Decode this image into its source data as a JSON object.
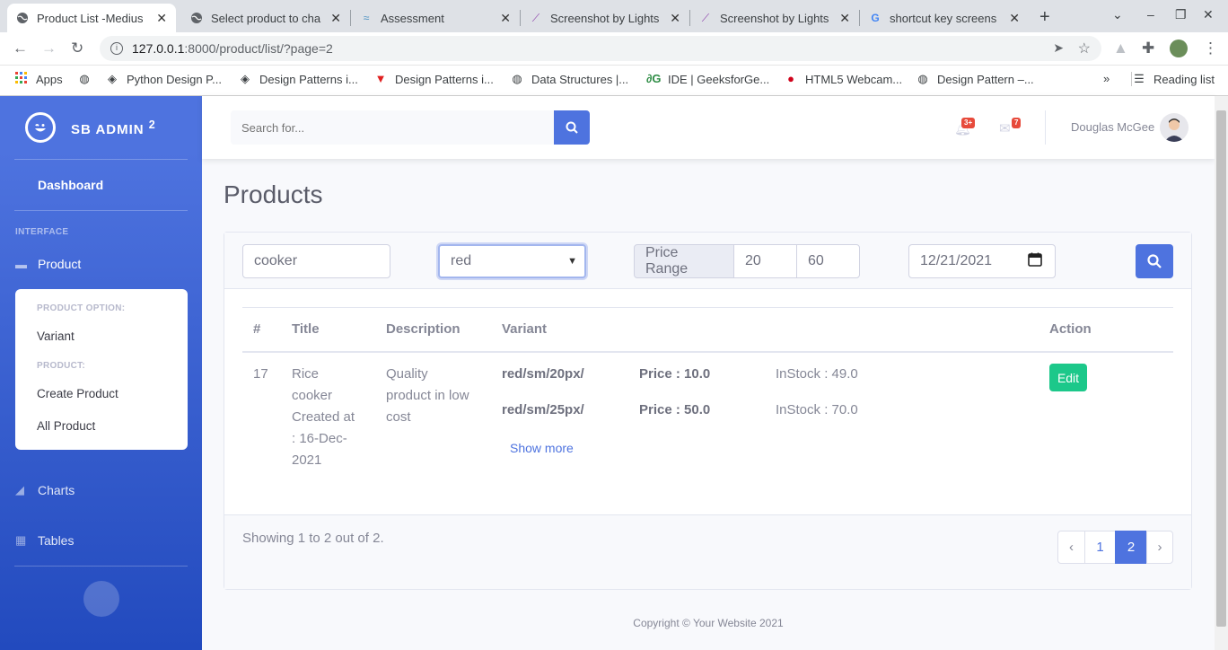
{
  "browser": {
    "tabs": [
      {
        "title": "Product List -Medius",
        "icon": "globe-icon",
        "active": true
      },
      {
        "title": "Select product to cha",
        "icon": "globe-icon"
      },
      {
        "title": "Assessment",
        "icon": "cloud-icon"
      },
      {
        "title": "Screenshot by Lights",
        "icon": "feather-icon"
      },
      {
        "title": "Screenshot by Lights",
        "icon": "feather-icon"
      },
      {
        "title": "shortcut key screens",
        "icon": "google-icon"
      }
    ],
    "url_host": "127.0.0.1",
    "url_path": ":8000/product/list/?page=2",
    "bookmarks": [
      {
        "label": "Apps",
        "icon": "apps-grid-icon"
      },
      {
        "label": "",
        "icon": "globe-icon"
      },
      {
        "label": "Python Design P...",
        "icon": "diamond-icon"
      },
      {
        "label": "Design Patterns i...",
        "icon": "diamond-icon"
      },
      {
        "label": "Design Patterns i...",
        "icon": "triangle-icon"
      },
      {
        "label": "Data Structures |...",
        "icon": "globe-icon"
      },
      {
        "label": "IDE | GeeksforGe...",
        "icon": "geeks-icon"
      },
      {
        "label": "HTML5 Webcam...",
        "icon": "red-dot-icon"
      },
      {
        "label": "Design Pattern –...",
        "icon": "globe-icon"
      }
    ],
    "reading_list": "Reading list"
  },
  "sidebar": {
    "brand": "SB ADMIN",
    "brand_sup": "2",
    "dashboard": "Dashboard",
    "interface_heading": "INTERFACE",
    "product": "Product",
    "product_option_heading": "PRODUCT OPTION:",
    "variant": "Variant",
    "product_heading": "PRODUCT:",
    "create_product": "Create Product",
    "all_product": "All Product",
    "charts": "Charts",
    "tables": "Tables"
  },
  "topbar": {
    "search_placeholder": "Search for...",
    "alerts_badge": "3+",
    "messages_badge": "7",
    "user_name": "Douglas McGee"
  },
  "page": {
    "title": "Products"
  },
  "filters": {
    "title_value": "cooker",
    "variant_selected": "red",
    "price_range_label": "Price Range",
    "price_from": "20",
    "price_to": "60",
    "date": "12/21/2021"
  },
  "table": {
    "headers": [
      "#",
      "Title",
      "Description",
      "Variant",
      "Action"
    ],
    "row": {
      "id": "17",
      "title_lines": [
        "Rice",
        "cooker",
        "Created at",
        ": 16-Dec-",
        "2021"
      ],
      "description_lines": [
        "Quality",
        "product in low",
        "cost"
      ],
      "variants": [
        {
          "name": "red/sm/20px/",
          "price": "Price : 10.0",
          "stock": "InStock : 49.0"
        },
        {
          "name": "red/sm/25px/",
          "price": "Price : 50.0",
          "stock": "InStock : 70.0"
        }
      ],
      "show_more": "Show more",
      "edit": "Edit"
    }
  },
  "footer": {
    "showing": "Showing 1 to 2 out of 2.",
    "pagination": [
      "‹",
      "1",
      "2",
      "›"
    ],
    "active_page": "2",
    "copyright": "Copyright © Your Website 2021"
  },
  "colors": {
    "primary": "#4e73df",
    "success": "#1cc88a",
    "danger": "#e74a3b"
  }
}
